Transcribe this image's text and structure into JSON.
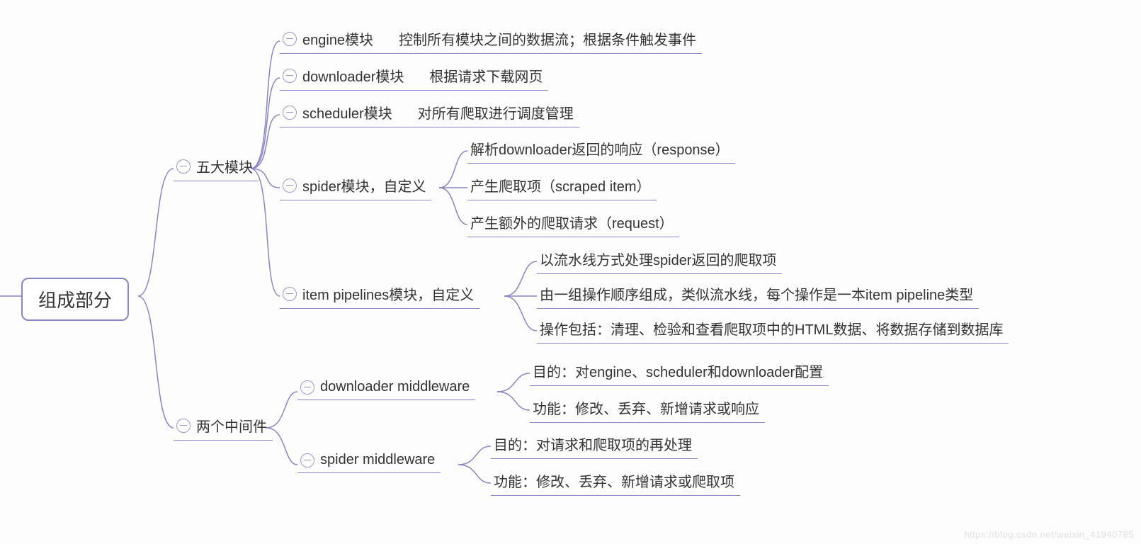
{
  "root": {
    "label": "组成部分"
  },
  "branch1": {
    "label": "五大模块",
    "children": {
      "engine": {
        "label": "engine模块",
        "desc": "控制所有模块之间的数据流；根据条件触发事件"
      },
      "downloader": {
        "label": "downloader模块",
        "desc": "根据请求下载网页"
      },
      "scheduler": {
        "label": "scheduler模块",
        "desc": "对所有爬取进行调度管理"
      },
      "spider": {
        "label": "spider模块，自定义",
        "leaves": [
          "解析downloader返回的响应（response）",
          "产生爬取项（scraped item）",
          "产生额外的爬取请求（request）"
        ]
      },
      "pipelines": {
        "label": "item pipelines模块，自定义",
        "leaves": [
          "以流水线方式处理spider返回的爬取项",
          "由一组操作顺序组成，类似流水线，每个操作是一本item pipeline类型",
          "操作包括：清理、检验和查看爬取项中的HTML数据、将数据存储到数据库"
        ]
      }
    }
  },
  "branch2": {
    "label": "两个中间件",
    "children": {
      "dlmw": {
        "label": "downloader middleware",
        "leaves": [
          "目的：对engine、scheduler和downloader配置",
          "功能：修改、丢弃、新增请求或响应"
        ]
      },
      "spmw": {
        "label": "spider middleware",
        "leaves": [
          "目的：对请求和爬取项的再处理",
          "功能：修改、丢弃、新增请求或爬取项"
        ]
      }
    }
  },
  "watermark": "https://blog.csdn.net/weixin_41940785"
}
